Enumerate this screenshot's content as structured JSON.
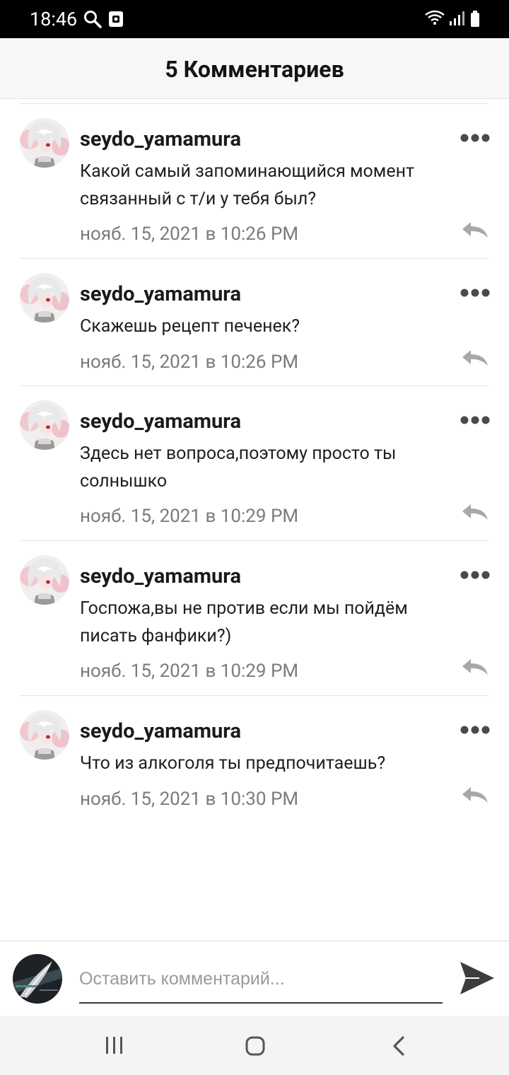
{
  "status_bar": {
    "time": "18:46",
    "icons": [
      "search-icon",
      "screenshot-icon",
      "wifi-icon",
      "signal-icon",
      "battery-icon"
    ]
  },
  "header": {
    "title": "5 Комментариев"
  },
  "comments": [
    {
      "author": "seydo_yamamura",
      "text": "Какой самый запоминающийся момент связанный с т/и у тебя был?",
      "time": "нояб. 15, 2021 в 10:26 PM"
    },
    {
      "author": "seydo_yamamura",
      "text": "Скажешь рецепт печенек?",
      "time": "нояб. 15, 2021 в 10:26 PM"
    },
    {
      "author": "seydo_yamamura",
      "text": "Здесь нет вопроса,поэтому просто ты солнышко",
      "time": "нояб. 15, 2021 в 10:29 PM"
    },
    {
      "author": "seydo_yamamura",
      "text": "Госпожа,вы не против если мы пойдём писать фанфики?)",
      "time": "нояб. 15, 2021 в 10:29 PM"
    },
    {
      "author": "seydo_yamamura",
      "text": "Что из алкоголя ты предпочитаешь?",
      "time": "нояб. 15, 2021 в 10:30 PM"
    }
  ],
  "composer": {
    "placeholder": "Оставить комментарий...",
    "value": ""
  },
  "nav_bar": {
    "icons": [
      "recent-apps-icon",
      "home-icon",
      "back-icon"
    ]
  },
  "colors": {
    "status_bar_bg": "#000000",
    "header_bg": "#f7f7f7",
    "timestamp": "#7b7b7b",
    "icon_gray": "#8a8a8a",
    "nav_bar_bg": "#f4f4f4"
  }
}
